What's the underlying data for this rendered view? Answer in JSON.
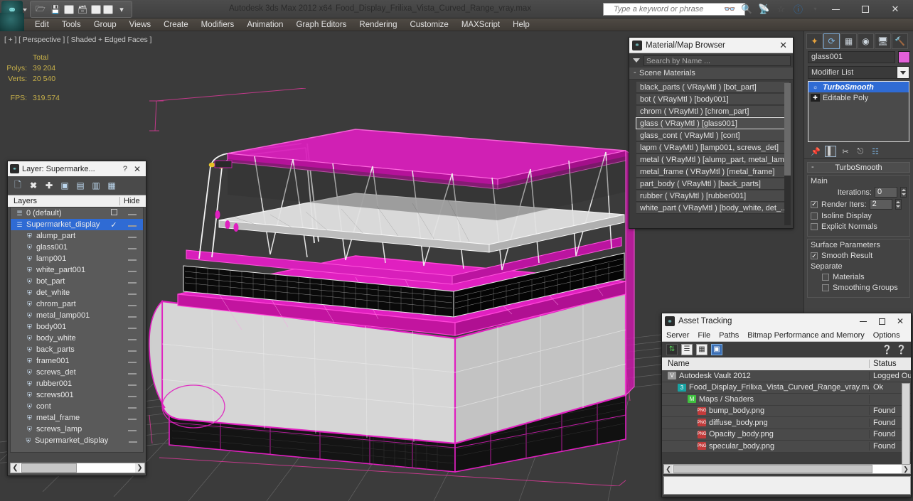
{
  "titlebar": {
    "app_title": "Autodesk 3ds Max  2012 x64",
    "file_name": "Food_Display_Frilixa_Vista_Curved_Range_vray.max",
    "search_placeholder": "Type a keyword or phrase",
    "quick_access": [
      "open-icon",
      "save-icon",
      "undo-icon",
      "redo-icon",
      "new-icon",
      "set-icon"
    ],
    "tool_icons": [
      "binoculars-icon",
      "magnifier-icon",
      "subscription-icon",
      "favorites-icon",
      "help-icon"
    ],
    "window_buttons": [
      "minimize",
      "maximize",
      "close"
    ]
  },
  "menubar": {
    "items": [
      "Edit",
      "Tools",
      "Group",
      "Views",
      "Create",
      "Modifiers",
      "Animation",
      "Graph Editors",
      "Rendering",
      "Customize",
      "MAXScript",
      "Help"
    ]
  },
  "viewport": {
    "label": "[ + ] [ Perspective ] [ Shaded + Edged Faces ]",
    "stats": {
      "total_header": "Total",
      "polys_label": "Polys:",
      "polys_value": "39 204",
      "verts_label": "Verts:",
      "verts_value": "20 540",
      "fps_label": "FPS:",
      "fps_value": "319.574"
    },
    "colors": {
      "background": "#3b3b3b",
      "selection_magenta": "#e020c0",
      "wire_white": "#f0f0f0",
      "grid": "#6e6e6e"
    }
  },
  "material_browser": {
    "title": "Material/Map Browser",
    "search_placeholder": "Search by Name ...",
    "group_label": "Scene Materials",
    "materials": [
      "black_parts  ( VRayMtl )  [bot_part]",
      "bot  ( VRayMtl )  [body001]",
      "chrom  ( VRayMtl )  [chrom_part]",
      "glass  ( VRayMtl )  [glass001]",
      "glass_cont  ( VRayMtl )  [cont]",
      "lapm  ( VRayMtl )  [lamp001, screws_det]",
      "metal  ( VRayMtl )  [alump_part, metal_lam...",
      "metal_frame  ( VRayMtl )  [metal_frame]",
      "part_body  ( VRayMtl )  [back_parts]",
      "rubber  ( VRayMtl )  [rubber001]",
      "white_part  ( VRayMtl )  [body_white, det_..."
    ],
    "selected_index": 3
  },
  "layer_dialog": {
    "title": "Layer: Supermarke...",
    "help_label": "?",
    "close_label": "✕",
    "toolbar_icons": [
      "new-layer-icon",
      "delete-layer-icon",
      "add-layer-icon",
      "select-objects-icon",
      "select-highlight-icon",
      "add-selection-icon",
      "set-current-icon"
    ],
    "columns": {
      "name": "Layers",
      "hide": "Hide"
    },
    "rows": [
      {
        "name": "0 (default)",
        "indent": 0,
        "checked": false,
        "box": true,
        "selected": false
      },
      {
        "name": "Supermarket_display",
        "indent": 0,
        "checked": true,
        "box": false,
        "selected": true
      },
      {
        "name": "alump_part",
        "indent": 1,
        "checked": false,
        "box": false,
        "selected": false
      },
      {
        "name": "glass001",
        "indent": 1,
        "checked": false,
        "box": false,
        "selected": false
      },
      {
        "name": "lamp001",
        "indent": 1,
        "checked": false,
        "box": false,
        "selected": false
      },
      {
        "name": "white_part001",
        "indent": 1,
        "checked": false,
        "box": false,
        "selected": false
      },
      {
        "name": "bot_part",
        "indent": 1,
        "checked": false,
        "box": false,
        "selected": false
      },
      {
        "name": "det_white",
        "indent": 1,
        "checked": false,
        "box": false,
        "selected": false
      },
      {
        "name": "chrom_part",
        "indent": 1,
        "checked": false,
        "box": false,
        "selected": false
      },
      {
        "name": "metal_lamp001",
        "indent": 1,
        "checked": false,
        "box": false,
        "selected": false
      },
      {
        "name": "body001",
        "indent": 1,
        "checked": false,
        "box": false,
        "selected": false
      },
      {
        "name": "body_white",
        "indent": 1,
        "checked": false,
        "box": false,
        "selected": false
      },
      {
        "name": "back_parts",
        "indent": 1,
        "checked": false,
        "box": false,
        "selected": false
      },
      {
        "name": "frame001",
        "indent": 1,
        "checked": false,
        "box": false,
        "selected": false
      },
      {
        "name": "screws_det",
        "indent": 1,
        "checked": false,
        "box": false,
        "selected": false
      },
      {
        "name": "rubber001",
        "indent": 1,
        "checked": false,
        "box": false,
        "selected": false
      },
      {
        "name": "screws001",
        "indent": 1,
        "checked": false,
        "box": false,
        "selected": false
      },
      {
        "name": "cont",
        "indent": 1,
        "checked": false,
        "box": false,
        "selected": false
      },
      {
        "name": "metal_frame",
        "indent": 1,
        "checked": false,
        "box": false,
        "selected": false
      },
      {
        "name": "screws_lamp",
        "indent": 1,
        "checked": false,
        "box": false,
        "selected": false
      },
      {
        "name": "Supermarket_display",
        "indent": 1,
        "checked": false,
        "box": false,
        "selected": false
      }
    ]
  },
  "command_panel": {
    "tabs": [
      "create-icon",
      "modify-icon",
      "hierarchy-icon",
      "motion-icon",
      "display-icon",
      "utilities-icon"
    ],
    "active_tab_index": 1,
    "object_name": "glass001",
    "object_color": "#e25fd8",
    "modifier_list_label": "Modifier List",
    "stack": [
      {
        "label": "TurboSmooth",
        "selected": true
      },
      {
        "label": "Editable Poly",
        "selected": false
      }
    ],
    "stack_tools": [
      "pin-stack-icon",
      "show-end-result-icon",
      "make-unique-icon",
      "remove-modifier-icon",
      "configure-sets-icon"
    ],
    "rollout": {
      "title": "TurboSmooth",
      "main_label": "Main",
      "iterations_label": "Iterations:",
      "iterations_value": "0",
      "render_iters_label": "Render Iters:",
      "render_iters_value": "2",
      "render_iters_checked": true,
      "isoline_display_label": "Isoline Display",
      "isoline_display_checked": false,
      "explicit_normals_label": "Explicit Normals",
      "explicit_normals_checked": false,
      "surface_params_label": "Surface Parameters",
      "smooth_result_label": "Smooth Result",
      "smooth_result_checked": true,
      "separate_label": "Separate",
      "materials_label": "Materials",
      "materials_checked": false,
      "smoothing_groups_label": "Smoothing Groups",
      "smoothing_groups_checked": false
    }
  },
  "asset_tracking": {
    "title": "Asset Tracking",
    "menu": [
      "Server",
      "File",
      "Paths",
      "Bitmap Performance and Memory",
      "Options"
    ],
    "toolbar_icons": [
      "refresh-icon",
      "list-view-icon",
      "detail-view-icon",
      "grid-view-icon",
      "help-cursor-icon",
      "help-icon"
    ],
    "columns": {
      "name": "Name",
      "status": "Status"
    },
    "rows": [
      {
        "name": "Autodesk Vault 2012",
        "status": "Logged Ou",
        "indent": 0,
        "icon": "vault"
      },
      {
        "name": "Food_Display_Frilixa_Vista_Curved_Range_vray.max",
        "status": "Ok",
        "indent": 1,
        "icon": "max"
      },
      {
        "name": "Maps / Shaders",
        "status": "",
        "indent": 2,
        "icon": "maps"
      },
      {
        "name": "bump_body.png",
        "status": "Found",
        "indent": 3,
        "icon": "png"
      },
      {
        "name": "diffuse_body.png",
        "status": "Found",
        "indent": 3,
        "icon": "png"
      },
      {
        "name": "Opacity _body.png",
        "status": "Found",
        "indent": 3,
        "icon": "png"
      },
      {
        "name": "specular_body.png",
        "status": "Found",
        "indent": 3,
        "icon": "png"
      }
    ]
  }
}
